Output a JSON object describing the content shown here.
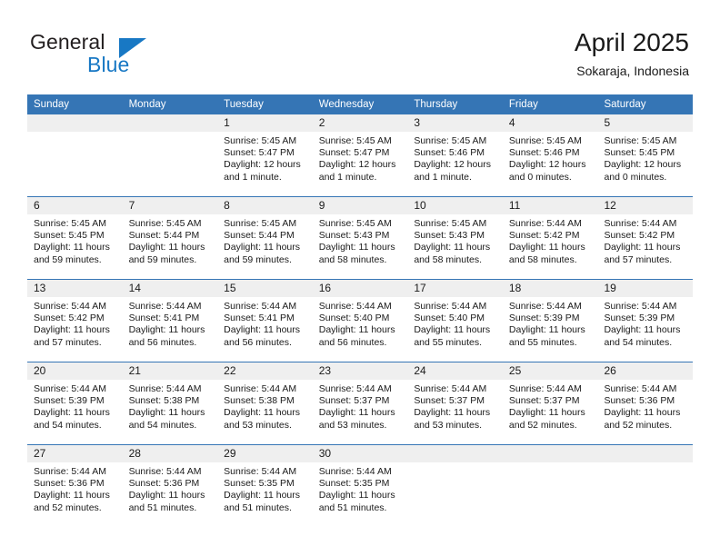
{
  "brand": {
    "word1": "General",
    "word2": "Blue",
    "triangle_color": "#1878c4",
    "text_color": "#231f20"
  },
  "header": {
    "title": "April 2025",
    "subtitle": "Sokaraja, Indonesia"
  },
  "theme": {
    "header_blue": "#3575b5",
    "date_band_grey": "#efefef",
    "text": "#1a1a1a"
  },
  "calendar": {
    "day_names": [
      "Sunday",
      "Monday",
      "Tuesday",
      "Wednesday",
      "Thursday",
      "Friday",
      "Saturday"
    ],
    "weeks": [
      [
        {
          "day": "",
          "empty": true,
          "sunrise": "",
          "sunset": "",
          "daylight1": "",
          "daylight2": ""
        },
        {
          "day": "",
          "empty": true,
          "sunrise": "",
          "sunset": "",
          "daylight1": "",
          "daylight2": ""
        },
        {
          "day": "1",
          "sunrise": "Sunrise: 5:45 AM",
          "sunset": "Sunset: 5:47 PM",
          "daylight1": "Daylight: 12 hours",
          "daylight2": "and 1 minute."
        },
        {
          "day": "2",
          "sunrise": "Sunrise: 5:45 AM",
          "sunset": "Sunset: 5:47 PM",
          "daylight1": "Daylight: 12 hours",
          "daylight2": "and 1 minute."
        },
        {
          "day": "3",
          "sunrise": "Sunrise: 5:45 AM",
          "sunset": "Sunset: 5:46 PM",
          "daylight1": "Daylight: 12 hours",
          "daylight2": "and 1 minute."
        },
        {
          "day": "4",
          "sunrise": "Sunrise: 5:45 AM",
          "sunset": "Sunset: 5:46 PM",
          "daylight1": "Daylight: 12 hours",
          "daylight2": "and 0 minutes."
        },
        {
          "day": "5",
          "sunrise": "Sunrise: 5:45 AM",
          "sunset": "Sunset: 5:45 PM",
          "daylight1": "Daylight: 12 hours",
          "daylight2": "and 0 minutes."
        }
      ],
      [
        {
          "day": "6",
          "sunrise": "Sunrise: 5:45 AM",
          "sunset": "Sunset: 5:45 PM",
          "daylight1": "Daylight: 11 hours",
          "daylight2": "and 59 minutes."
        },
        {
          "day": "7",
          "sunrise": "Sunrise: 5:45 AM",
          "sunset": "Sunset: 5:44 PM",
          "daylight1": "Daylight: 11 hours",
          "daylight2": "and 59 minutes."
        },
        {
          "day": "8",
          "sunrise": "Sunrise: 5:45 AM",
          "sunset": "Sunset: 5:44 PM",
          "daylight1": "Daylight: 11 hours",
          "daylight2": "and 59 minutes."
        },
        {
          "day": "9",
          "sunrise": "Sunrise: 5:45 AM",
          "sunset": "Sunset: 5:43 PM",
          "daylight1": "Daylight: 11 hours",
          "daylight2": "and 58 minutes."
        },
        {
          "day": "10",
          "sunrise": "Sunrise: 5:45 AM",
          "sunset": "Sunset: 5:43 PM",
          "daylight1": "Daylight: 11 hours",
          "daylight2": "and 58 minutes."
        },
        {
          "day": "11",
          "sunrise": "Sunrise: 5:44 AM",
          "sunset": "Sunset: 5:42 PM",
          "daylight1": "Daylight: 11 hours",
          "daylight2": "and 58 minutes."
        },
        {
          "day": "12",
          "sunrise": "Sunrise: 5:44 AM",
          "sunset": "Sunset: 5:42 PM",
          "daylight1": "Daylight: 11 hours",
          "daylight2": "and 57 minutes."
        }
      ],
      [
        {
          "day": "13",
          "sunrise": "Sunrise: 5:44 AM",
          "sunset": "Sunset: 5:42 PM",
          "daylight1": "Daylight: 11 hours",
          "daylight2": "and 57 minutes."
        },
        {
          "day": "14",
          "sunrise": "Sunrise: 5:44 AM",
          "sunset": "Sunset: 5:41 PM",
          "daylight1": "Daylight: 11 hours",
          "daylight2": "and 56 minutes."
        },
        {
          "day": "15",
          "sunrise": "Sunrise: 5:44 AM",
          "sunset": "Sunset: 5:41 PM",
          "daylight1": "Daylight: 11 hours",
          "daylight2": "and 56 minutes."
        },
        {
          "day": "16",
          "sunrise": "Sunrise: 5:44 AM",
          "sunset": "Sunset: 5:40 PM",
          "daylight1": "Daylight: 11 hours",
          "daylight2": "and 56 minutes."
        },
        {
          "day": "17",
          "sunrise": "Sunrise: 5:44 AM",
          "sunset": "Sunset: 5:40 PM",
          "daylight1": "Daylight: 11 hours",
          "daylight2": "and 55 minutes."
        },
        {
          "day": "18",
          "sunrise": "Sunrise: 5:44 AM",
          "sunset": "Sunset: 5:39 PM",
          "daylight1": "Daylight: 11 hours",
          "daylight2": "and 55 minutes."
        },
        {
          "day": "19",
          "sunrise": "Sunrise: 5:44 AM",
          "sunset": "Sunset: 5:39 PM",
          "daylight1": "Daylight: 11 hours",
          "daylight2": "and 54 minutes."
        }
      ],
      [
        {
          "day": "20",
          "sunrise": "Sunrise: 5:44 AM",
          "sunset": "Sunset: 5:39 PM",
          "daylight1": "Daylight: 11 hours",
          "daylight2": "and 54 minutes."
        },
        {
          "day": "21",
          "sunrise": "Sunrise: 5:44 AM",
          "sunset": "Sunset: 5:38 PM",
          "daylight1": "Daylight: 11 hours",
          "daylight2": "and 54 minutes."
        },
        {
          "day": "22",
          "sunrise": "Sunrise: 5:44 AM",
          "sunset": "Sunset: 5:38 PM",
          "daylight1": "Daylight: 11 hours",
          "daylight2": "and 53 minutes."
        },
        {
          "day": "23",
          "sunrise": "Sunrise: 5:44 AM",
          "sunset": "Sunset: 5:37 PM",
          "daylight1": "Daylight: 11 hours",
          "daylight2": "and 53 minutes."
        },
        {
          "day": "24",
          "sunrise": "Sunrise: 5:44 AM",
          "sunset": "Sunset: 5:37 PM",
          "daylight1": "Daylight: 11 hours",
          "daylight2": "and 53 minutes."
        },
        {
          "day": "25",
          "sunrise": "Sunrise: 5:44 AM",
          "sunset": "Sunset: 5:37 PM",
          "daylight1": "Daylight: 11 hours",
          "daylight2": "and 52 minutes."
        },
        {
          "day": "26",
          "sunrise": "Sunrise: 5:44 AM",
          "sunset": "Sunset: 5:36 PM",
          "daylight1": "Daylight: 11 hours",
          "daylight2": "and 52 minutes."
        }
      ],
      [
        {
          "day": "27",
          "sunrise": "Sunrise: 5:44 AM",
          "sunset": "Sunset: 5:36 PM",
          "daylight1": "Daylight: 11 hours",
          "daylight2": "and 52 minutes."
        },
        {
          "day": "28",
          "sunrise": "Sunrise: 5:44 AM",
          "sunset": "Sunset: 5:36 PM",
          "daylight1": "Daylight: 11 hours",
          "daylight2": "and 51 minutes."
        },
        {
          "day": "29",
          "sunrise": "Sunrise: 5:44 AM",
          "sunset": "Sunset: 5:35 PM",
          "daylight1": "Daylight: 11 hours",
          "daylight2": "and 51 minutes."
        },
        {
          "day": "30",
          "sunrise": "Sunrise: 5:44 AM",
          "sunset": "Sunset: 5:35 PM",
          "daylight1": "Daylight: 11 hours",
          "daylight2": "and 51 minutes."
        },
        {
          "day": "",
          "empty": true,
          "sunrise": "",
          "sunset": "",
          "daylight1": "",
          "daylight2": ""
        },
        {
          "day": "",
          "empty": true,
          "sunrise": "",
          "sunset": "",
          "daylight1": "",
          "daylight2": ""
        },
        {
          "day": "",
          "empty": true,
          "sunrise": "",
          "sunset": "",
          "daylight1": "",
          "daylight2": ""
        }
      ]
    ]
  }
}
